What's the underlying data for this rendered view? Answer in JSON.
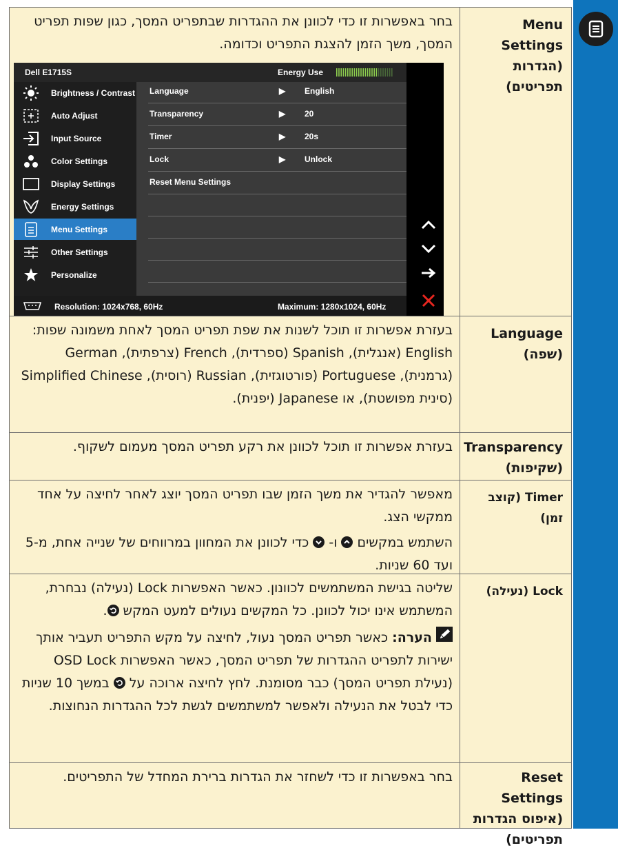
{
  "rows": [
    {
      "name_en": "Menu Settings",
      "name_he": "(הגדרות תפריטים)",
      "desc": "בחר באפשרות זו כדי לכוונן את ההגדרות שבתפריט המסך, כגון שפות תפריט המסך, משך הזמן להצגת התפריט וכדומה."
    },
    {
      "name_en": "Language",
      "name_he": "(שפה)",
      "desc": "בעזרת אפשרות זו תוכל לשנות את שפת תפריט המסך לאחת משמונה שפות: English (אנגלית), Spanish (ספרדית), French (צרפתית), German (גרמנית), Portuguese (פורטוגזית), Russian (רוסית), Simplified Chinese (סינית מפושטת), או Japanese (יפנית)."
    },
    {
      "name_en": "Transparency",
      "name_he": "(שקיפות)",
      "desc": "בעזרת אפשרות זו תוכל לכוונן את רקע תפריט המסך מעמום לשקוף."
    },
    {
      "name_en": "Timer",
      "name_he": "(קוצב זמן)",
      "desc1": "מאפשר להגדיר את משך הזמן שבו תפריט המסך יוצג לאחר לחיצה על אחד ממקשי הצג.",
      "desc2a": "השתמש במקשים",
      "desc2b": "ו-",
      "desc2c": "כדי לכוונן את המחוון במרווחים של שנייה אחת, מ-5 ועד 60 שניות."
    },
    {
      "name_en": "Lock",
      "name_he": "(נעילה)",
      "desc1": "שליטה בגישת המשתמשים לכוונון. כאשר האפשרות Lock (נעילה) נבחרת, המשתמש אינו יכול לכוונן. כל המקשים נעולים למעט המקש",
      "note_label": "הערה:",
      "note_a": "כאשר תפריט המסך נעול, לחיצה על מקש התפריט תעביר אותך ישירות לתפריט ההגדרות של תפריט המסך, כאשר האפשרות OSD Lock (נעילת תפריט המסך) כבר מסומנת. לחץ לחיצה ארוכה על",
      "note_b": "במשך 10 שניות כדי לבטל את הנעילה ולאפשר למשתמשים לגשת לכל ההגדרות הנחוצות."
    },
    {
      "name_en": "Reset Settings",
      "name_he": "(איפוס הגדרות תפריטים)",
      "desc": "בחר באפשרות זו כדי לשחזר את הגדרות ברירת המחדל של התפריטים."
    }
  ],
  "osd": {
    "model": "Dell E1715S",
    "energy_label": "Energy Use",
    "menu": [
      {
        "label": "Brightness / Contrast",
        "icon": "brightness-icon"
      },
      {
        "label": "Auto Adjust",
        "icon": "auto-adjust-icon"
      },
      {
        "label": "Input Source",
        "icon": "input-source-icon"
      },
      {
        "label": "Color Settings",
        "icon": "color-settings-icon"
      },
      {
        "label": "Display Settings",
        "icon": "display-settings-icon"
      },
      {
        "label": "Energy Settings",
        "icon": "energy-settings-icon"
      },
      {
        "label": "Menu Settings",
        "icon": "menu-settings-icon"
      },
      {
        "label": "Other Settings",
        "icon": "other-settings-icon"
      },
      {
        "label": "Personalize",
        "icon": "star-icon"
      }
    ],
    "submenu": [
      {
        "label": "Language",
        "value": "English"
      },
      {
        "label": "Transparency",
        "value": "20"
      },
      {
        "label": "Timer",
        "value": "20s"
      },
      {
        "label": "Lock",
        "value": "Unlock"
      },
      {
        "label": "Reset Menu Settings",
        "value": ""
      }
    ],
    "resolution": "Resolution: 1024x768, 60Hz",
    "maximum": "Maximum: 1280x1024, 60Hz",
    "selected_color": "#2a7ec6"
  }
}
